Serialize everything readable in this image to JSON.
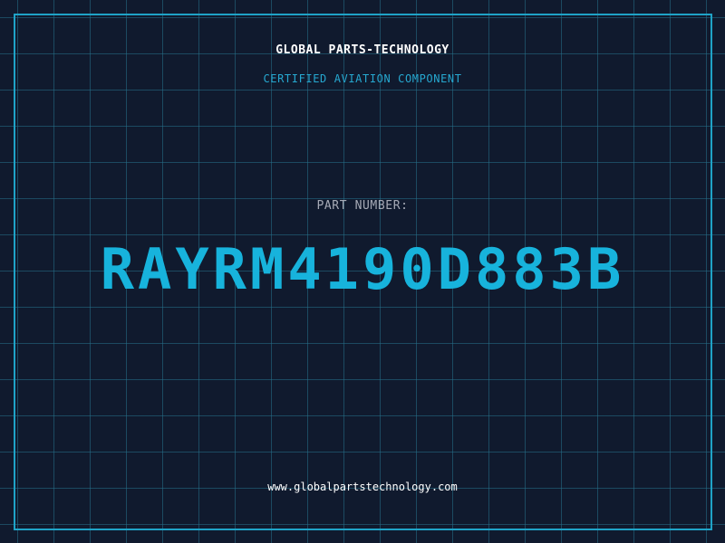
{
  "header": {
    "company_name": "GLOBAL PARTS-TECHNOLOGY",
    "tagline": "CERTIFIED AVIATION COMPONENT"
  },
  "part": {
    "label": "PART NUMBER:",
    "number": "RAYRM4190D883B"
  },
  "footer": {
    "website": "www.globalpartstechnology.com"
  },
  "colors": {
    "background": "#101a2e",
    "grid": "#26708a",
    "accent": "#17b3dc",
    "frame": "#1fa3c7"
  }
}
